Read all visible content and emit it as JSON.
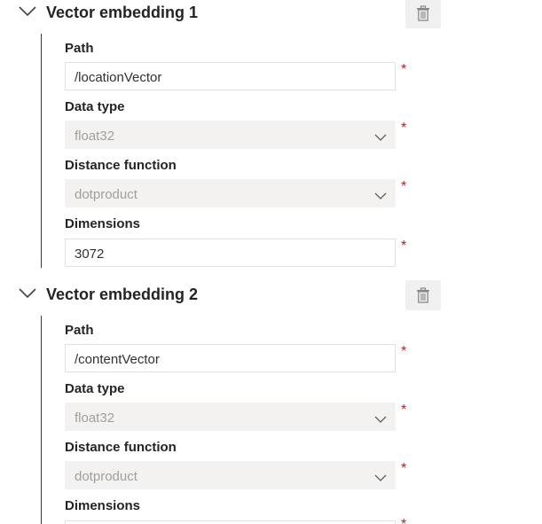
{
  "embeddings": [
    {
      "title": "Vector embedding 1",
      "path_label": "Path",
      "path_value": "/locationVector",
      "datatype_label": "Data type",
      "datatype_value": "float32",
      "distance_label": "Distance function",
      "distance_value": "dotproduct",
      "dimensions_label": "Dimensions",
      "dimensions_value": "3072",
      "required_mark": "*"
    },
    {
      "title": "Vector embedding 2",
      "path_label": "Path",
      "path_value": "/contentVector",
      "datatype_label": "Data type",
      "datatype_value": "float32",
      "distance_label": "Distance function",
      "distance_value": "dotproduct",
      "dimensions_label": "Dimensions",
      "dimensions_value": "",
      "required_mark": "*"
    }
  ],
  "icons": {
    "collapse": "chevron-down-icon",
    "delete": "trash-icon",
    "dropdown": "chevron-down-icon"
  },
  "colors": {
    "required": "#a4262c",
    "disabled_bg": "#f3f2f1",
    "disabled_text": "#a19f9d",
    "delete_button_bg": "#f0f0f0"
  }
}
